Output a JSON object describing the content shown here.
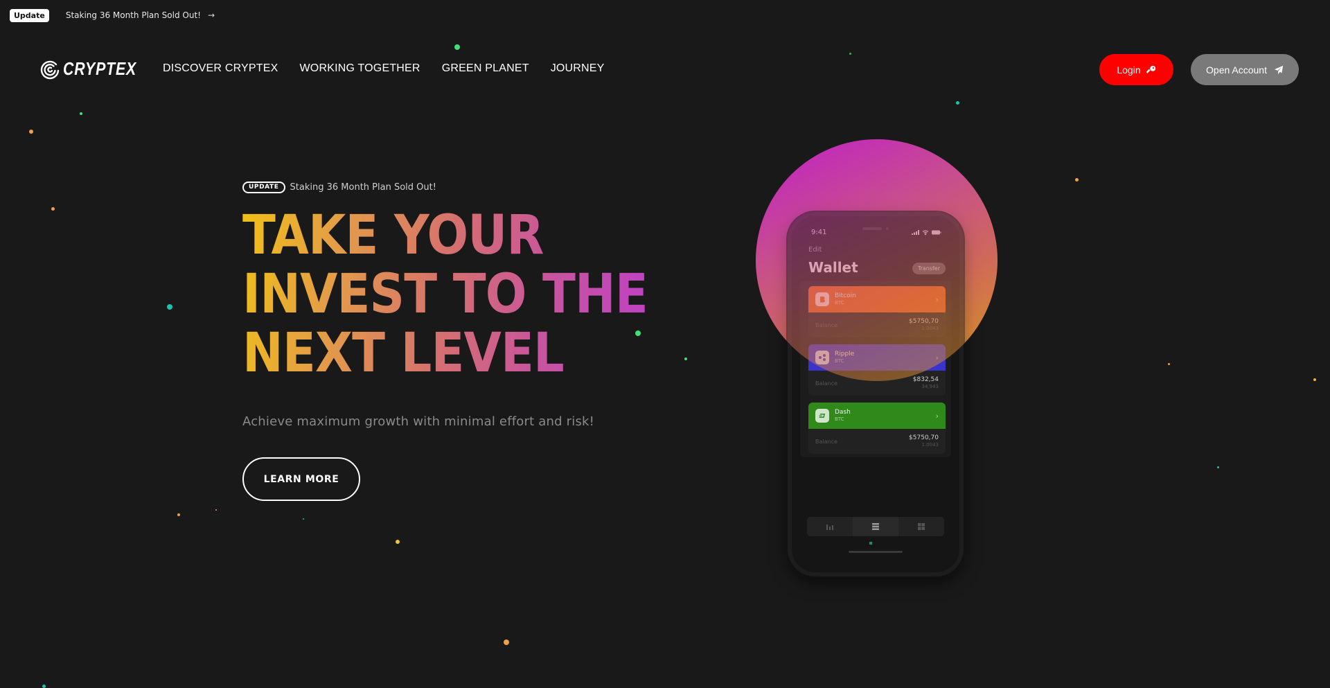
{
  "announcement": {
    "badge": "Update",
    "message": "Staking 36 Month Plan Sold Out!",
    "arrow": "→"
  },
  "brand": {
    "name": "CRYPTEX",
    "logo_icon": "swirl-logo-icon"
  },
  "nav": {
    "items": [
      {
        "label": "DISCOVER CRYPTEX"
      },
      {
        "label": "WORKING TOGETHER"
      },
      {
        "label": "GREEN PLANET"
      },
      {
        "label": "JOURNEY"
      }
    ]
  },
  "actions": {
    "login": {
      "label": "Login",
      "icon": "key-icon",
      "color": "#ff0000"
    },
    "open_account": {
      "label": "Open Account",
      "icon": "paper-plane-icon",
      "color": "#7a7a7a"
    }
  },
  "hero": {
    "pill": "UPDATE",
    "pill_text": "Staking 36 Month Plan Sold Out!",
    "headline": [
      "TAKE YOUR",
      "INVEST TO THE",
      "NEXT LEVEL"
    ],
    "gradient": [
      "#f0c018",
      "#d6706f",
      "#be3fc8"
    ],
    "subtitle": "Achieve maximum growth with minimal effort and risk!",
    "cta": "LEARN MORE"
  },
  "phone": {
    "time": "9:41",
    "edit": "Edit",
    "title": "Wallet",
    "transfer": "Transfer",
    "balance_label": "Balance",
    "cards": [
      {
        "name": "Bitcoin",
        "symbol": "BTC",
        "amount": "$5750,70",
        "quantity": "1.0043",
        "color": "#e8651c",
        "icon": "bitcoin-icon"
      },
      {
        "name": "Ripple",
        "symbol": "BTC",
        "amount": "$832,54",
        "quantity": "34,943",
        "color": "#3a34c8",
        "icon": "ripple-icon"
      },
      {
        "name": "Dash",
        "symbol": "BTC",
        "amount": "$5750,70",
        "quantity": "1.0043",
        "color": "#2f8a1a",
        "icon": "dash-icon"
      }
    ],
    "tabs": [
      {
        "icon": "chart-icon",
        "active": false
      },
      {
        "icon": "list-icon",
        "active": true
      },
      {
        "icon": "grid-icon",
        "active": false
      }
    ]
  }
}
